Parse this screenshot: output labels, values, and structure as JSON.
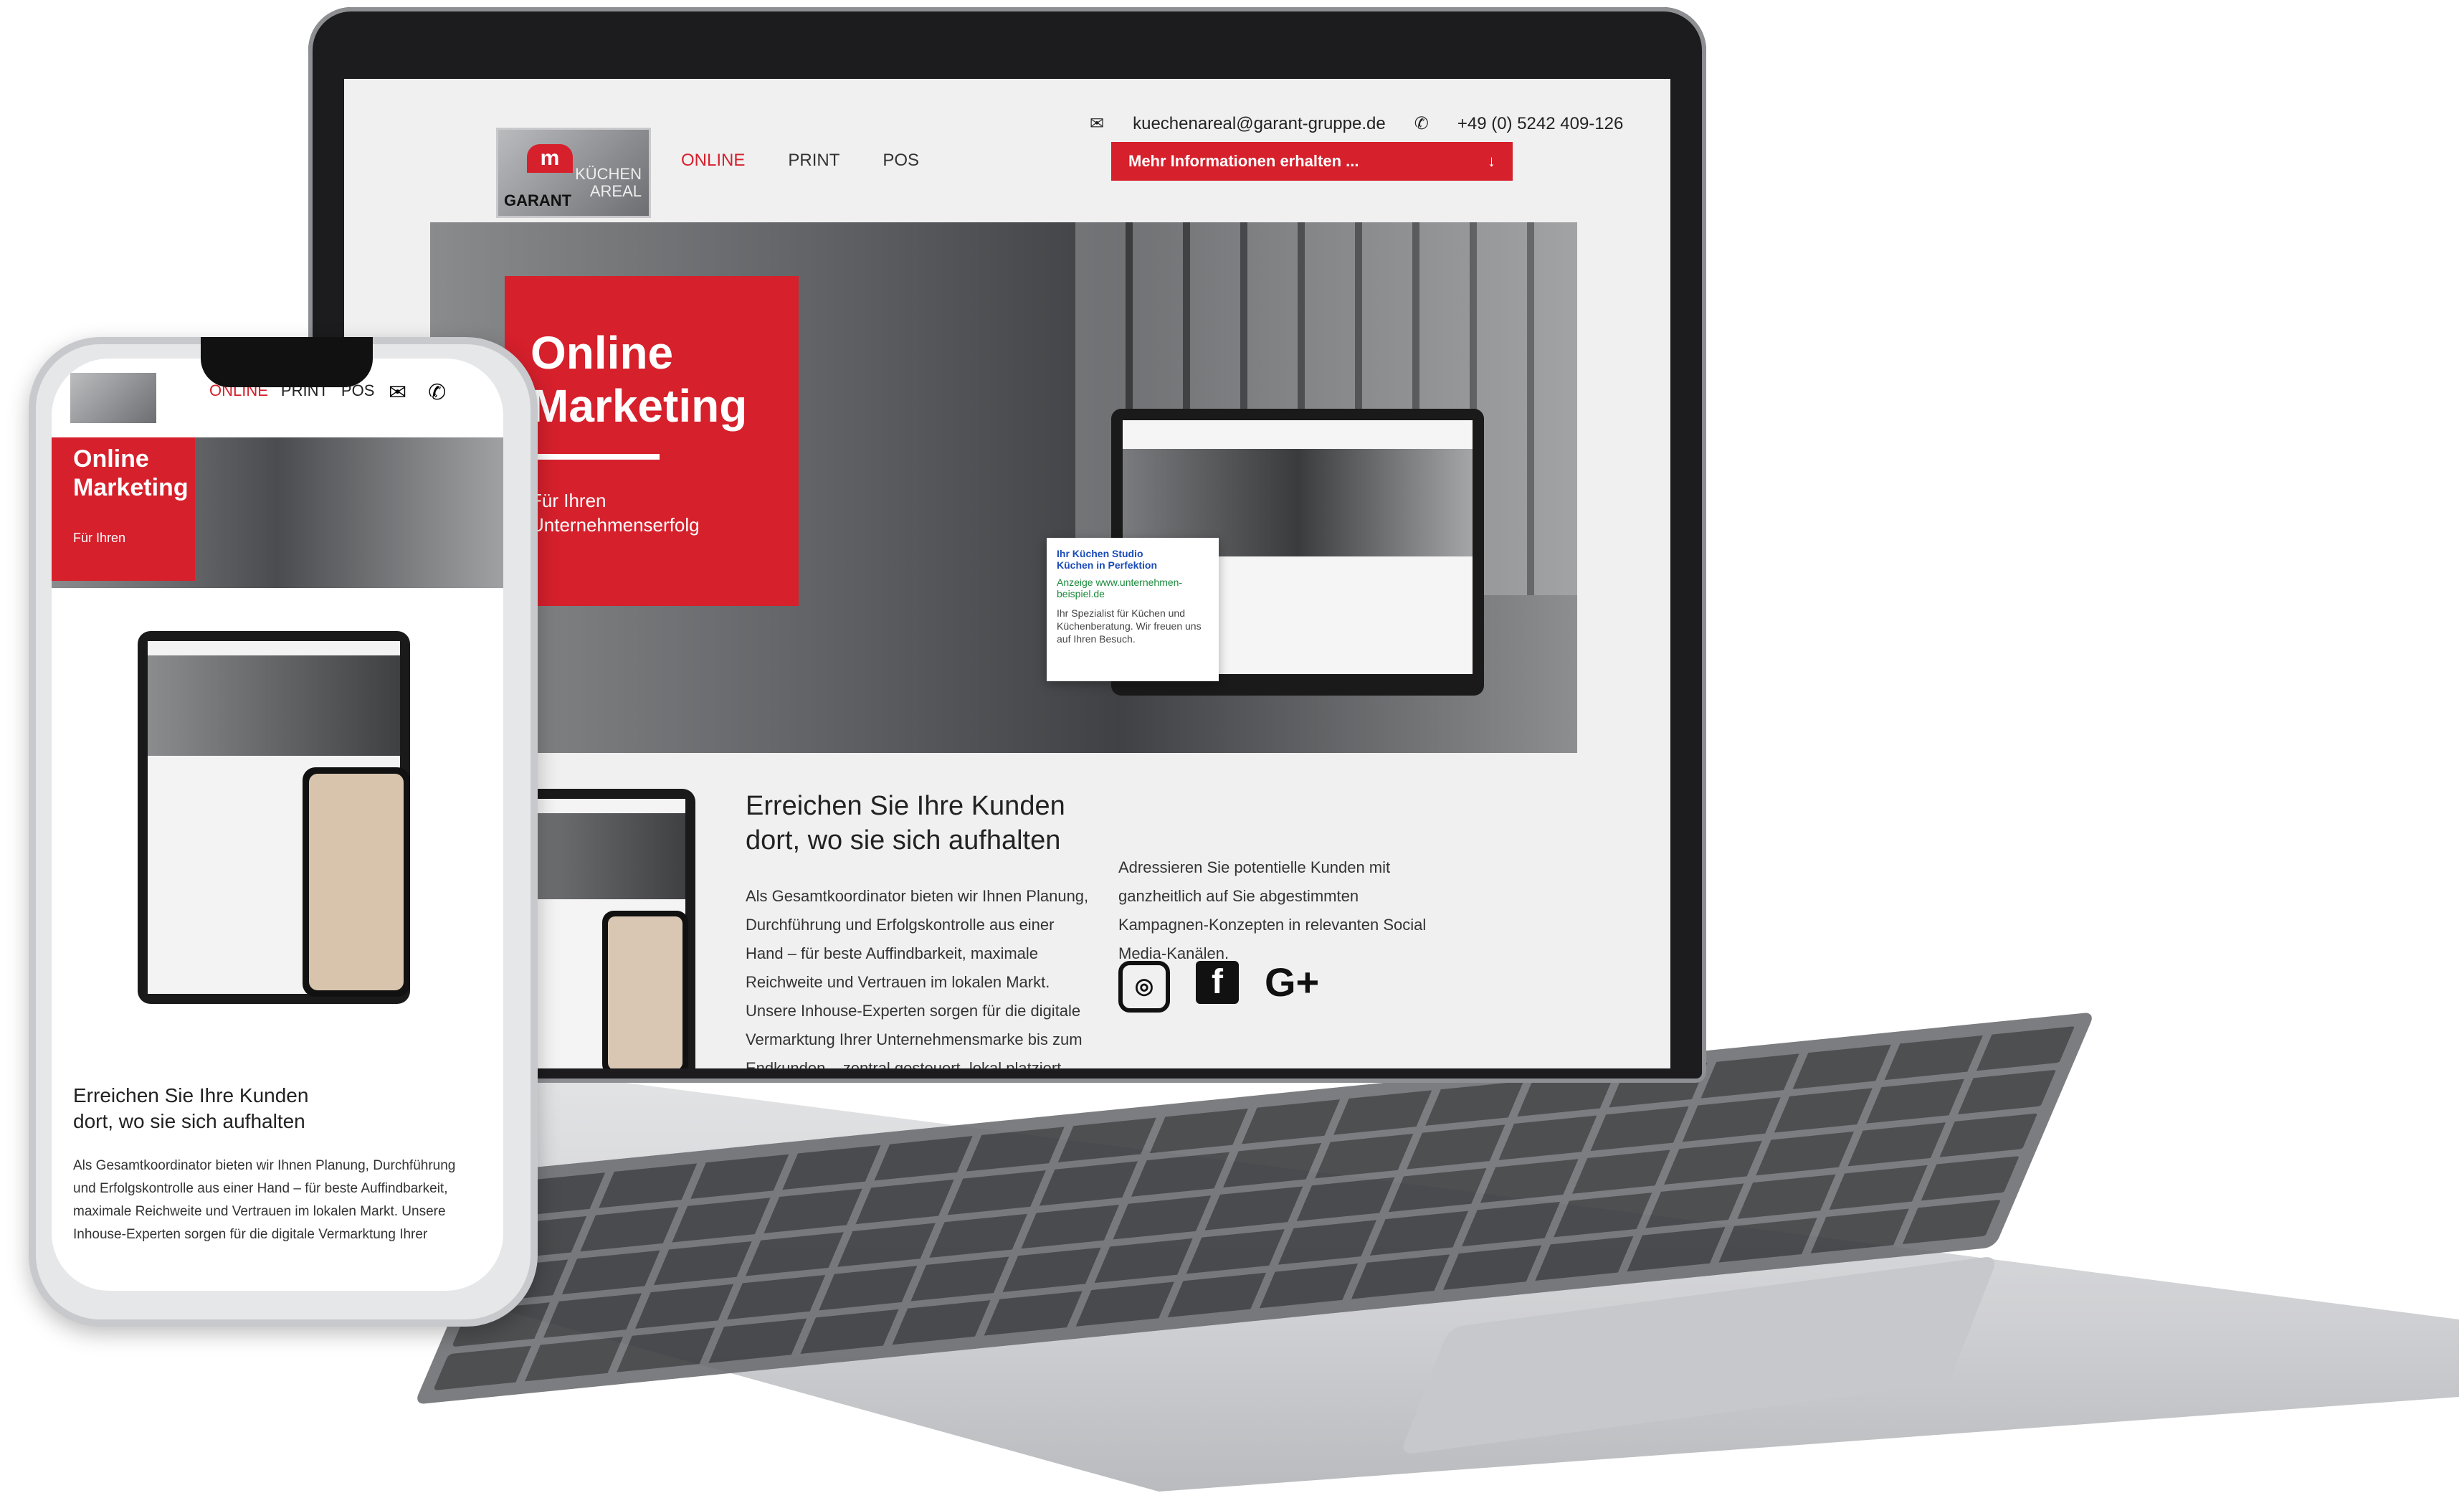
{
  "laptop": {
    "contact_email": "kuechenareal@garant-gruppe.de",
    "contact_phone": "+49 (0) 5242 409-126",
    "cta": "Mehr Informationen erhalten ...",
    "logo_m": "m",
    "logo_garant": "GARANT",
    "logo_kuechen": "KÜCHEN",
    "logo_areal": "AREAL",
    "nav": [
      {
        "label": "ONLINE"
      },
      {
        "label": "PRINT"
      },
      {
        "label": "POS"
      }
    ],
    "hero_title_1": "Online",
    "hero_title_2": "Marketing",
    "hero_sub_1": "Für Ihren",
    "hero_sub_2": "Unternehmenserfolg",
    "ad_title_1": "Ihr Küchen Studio",
    "ad_title_2": "Küchen in Perfektion",
    "ad_tag": "Anzeige",
    "ad_url": "www.unternehmen-beispiel.de",
    "ad_desc": "Ihr Spezialist für Küchen und Küchenberatung. Wir freuen uns auf Ihren Besuch.",
    "section_title_1": "Erreichen Sie Ihre Kunden",
    "section_title_2": "dort, wo sie sich aufhalten",
    "section_body": "Als Gesamtkoordinator bieten wir Ihnen Planung, Durchführung und Erfolgskontrolle aus einer Hand – für beste Auffindbarkeit, maximale Reichweite und Vertrauen im lokalen Markt. Unsere Inhouse-Experten sorgen für die digitale Vermarktung Ihrer Unternehmensmarke bis zum Endkunden – zentral gesteuert, lokal platziert.",
    "section_body2": "Adressieren Sie potentielle Kunden mit ganzheitlich auf Sie abgestimmten Kampagnen-Konzepten in relevanten Social Media-Kanälen.",
    "social_ig": "◎",
    "social_fb": "f",
    "social_gplus": "G+"
  },
  "phone": {
    "nav": [
      {
        "label": "ONLINE"
      },
      {
        "label": "PRINT"
      },
      {
        "label": "POS"
      }
    ],
    "hero_title_1": "Online",
    "hero_title_2": "Marketing",
    "hero_sub": "Für Ihren",
    "section_title_1": "Erreichen Sie Ihre Kunden",
    "section_title_2": "dort, wo sie sich aufhalten",
    "section_body": "Als Gesamtkoordinator bieten wir Ihnen Planung, Durchführung und Erfolgskontrolle aus einer Hand – für beste Auffindbarkeit, maximale Reichweite und Vertrauen im lokalen Markt. Unsere Inhouse-Experten sorgen für die digitale Vermarktung Ihrer",
    "mail_icon": "mail-icon",
    "phone_icon": "phone-icon"
  },
  "colors": {
    "accent": "#d6202c"
  }
}
